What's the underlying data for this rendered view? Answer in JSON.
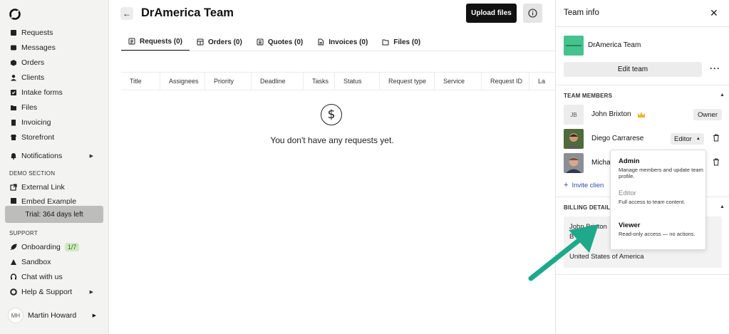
{
  "sidebar": {
    "items": [
      {
        "label": "Requests",
        "icon": "layers-icon"
      },
      {
        "label": "Messages",
        "icon": "message-icon"
      },
      {
        "label": "Orders",
        "icon": "box-icon"
      },
      {
        "label": "Clients",
        "icon": "users-icon"
      },
      {
        "label": "Intake forms",
        "icon": "checkbox-icon"
      },
      {
        "label": "Files",
        "icon": "folder-icon"
      },
      {
        "label": "Invoicing",
        "icon": "invoice-icon"
      },
      {
        "label": "Storefront",
        "icon": "store-icon"
      },
      {
        "label": "Notifications",
        "icon": "bell-icon"
      }
    ],
    "demo_section_label": "DEMO SECTION",
    "demo_items": [
      {
        "label": "External Link",
        "icon": "external-link-icon"
      },
      {
        "label": "Embed Example",
        "icon": "embed-icon"
      }
    ],
    "trial_label": "Trial: 364 days left",
    "support_label": "SUPPORT",
    "support_items": [
      {
        "label": "Onboarding",
        "badge": "1/7",
        "icon": "rocket-icon"
      },
      {
        "label": "Sandbox",
        "icon": "sandbox-icon"
      },
      {
        "label": "Chat with us",
        "icon": "headset-icon"
      },
      {
        "label": "Help & Support",
        "icon": "lifebuoy-icon"
      }
    ],
    "user": {
      "initials": "MH",
      "name": "Martin Howard"
    }
  },
  "main": {
    "title": "DrAmerica Team",
    "upload_label": "Upload files",
    "tabs": [
      {
        "label": "Requests (0)",
        "active": true
      },
      {
        "label": "Orders (0)"
      },
      {
        "label": "Quotes (0)"
      },
      {
        "label": "Invoices (0)"
      },
      {
        "label": "Files (0)"
      }
    ],
    "columns": [
      "Title",
      "Assignees",
      "Priority",
      "Deadline",
      "Tasks",
      "Status",
      "Request type",
      "Service",
      "Request ID",
      "La"
    ],
    "empty_text": "You don't have any requests yet."
  },
  "panel": {
    "title": "Team info",
    "team_name": "DrAmerica Team",
    "edit_label": "Edit team",
    "members_title": "TEAM MEMBERS",
    "members": [
      {
        "initials": "JB",
        "name": "John Brixton",
        "role": "Owner"
      },
      {
        "name": "Diego Carrarese",
        "role": "Editor"
      },
      {
        "name": "Micha"
      }
    ],
    "invite_label": "Invite clien",
    "billing_title": "BILLING DETAILS",
    "billing_lines": [
      "John Brixton",
      "B",
      "",
      "United States of America"
    ]
  },
  "role_menu": [
    {
      "title": "Admin",
      "desc": "Manage members and update team profile."
    },
    {
      "title": "Editor",
      "desc": "Full access to team content.",
      "muted": true
    },
    {
      "title": "Viewer",
      "desc": "Read-only access — no actions."
    }
  ],
  "colors": {
    "arrow": "#1ea98a",
    "team_logo": "#45c38f",
    "crown": "#e8b62a"
  }
}
